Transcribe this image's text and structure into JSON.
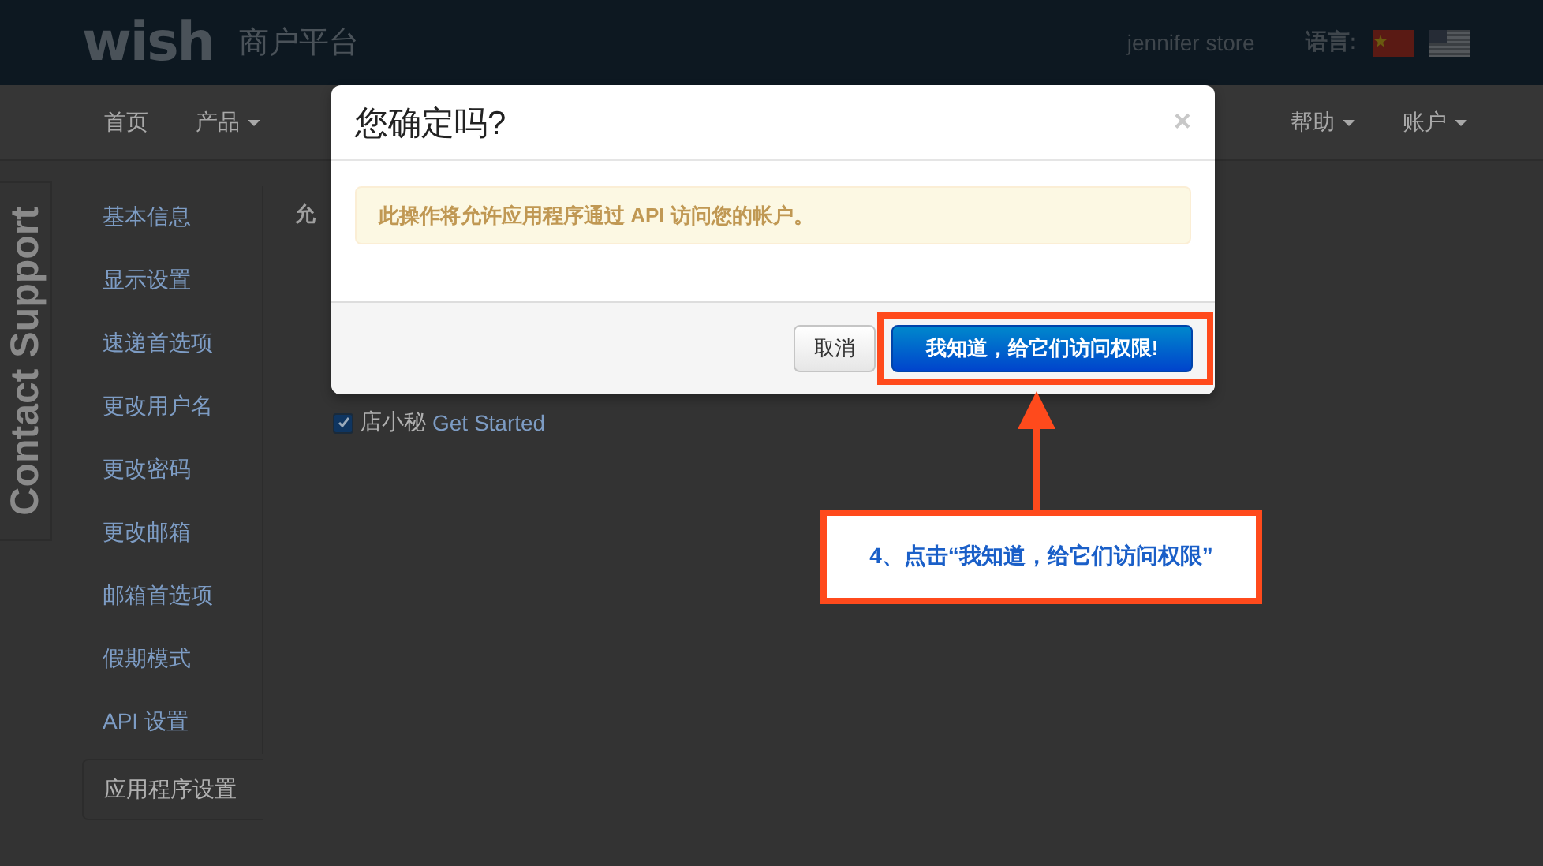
{
  "header": {
    "logo": "wish",
    "platform": "商户平台",
    "store": "jennifer store",
    "language_label": "语言:"
  },
  "nav": {
    "left": [
      {
        "label": "首页",
        "dropdown": false
      },
      {
        "label": "产品",
        "dropdown": true
      }
    ],
    "right": [
      {
        "label": "帮助",
        "dropdown": true
      },
      {
        "label": "账户",
        "dropdown": true
      }
    ]
  },
  "contact_tab": "Contact Support",
  "sidebar": [
    {
      "label": "基本信息",
      "selected": false
    },
    {
      "label": "显示设置",
      "selected": false
    },
    {
      "label": "速递首选项",
      "selected": false
    },
    {
      "label": "更改用户名",
      "selected": false
    },
    {
      "label": "更改密码",
      "selected": false
    },
    {
      "label": "更改邮箱",
      "selected": false
    },
    {
      "label": "邮箱首选项",
      "selected": false
    },
    {
      "label": "假期模式",
      "selected": false
    },
    {
      "label": "API 设置",
      "selected": false
    },
    {
      "label": "应用程序设置",
      "selected": true
    }
  ],
  "content": {
    "heading": "允",
    "option": {
      "checked": true,
      "label": "店小秘",
      "link": "Get Started"
    }
  },
  "modal": {
    "title": "您确定吗?",
    "close": "×",
    "alert": "此操作将允许应用程序通过 API 访问您的帐户。",
    "buttons": [
      {
        "label": "取消",
        "kind": "default",
        "highlighted": false
      },
      {
        "label": "我知道，给它们访问权限!",
        "kind": "primary",
        "highlighted": true
      }
    ]
  },
  "callout": "4、点击“我知道，给它们访问权限”"
}
